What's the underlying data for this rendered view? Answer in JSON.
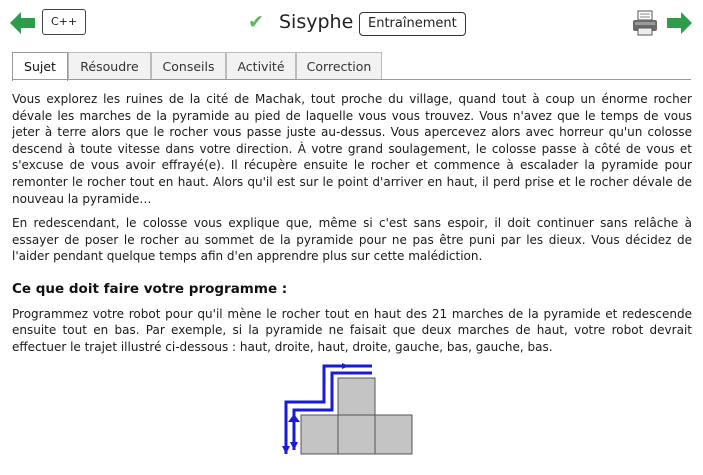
{
  "header": {
    "language": "C++",
    "title": "Sisyphe",
    "mode": "Entraînement",
    "colors": {
      "arrow": "#2e9c4a",
      "check": "#5cb85c"
    },
    "icons": [
      "prev-arrow-icon",
      "check-icon",
      "printer-icon",
      "next-arrow-icon"
    ]
  },
  "tabs": [
    {
      "label": "Sujet",
      "active": true
    },
    {
      "label": "Résoudre",
      "active": false
    },
    {
      "label": "Conseils",
      "active": false
    },
    {
      "label": "Activité",
      "active": false
    },
    {
      "label": "Correction",
      "active": false
    }
  ],
  "content": {
    "p1": "Vous explorez les ruines de la cité de Machak, tout proche du village, quand tout à coup un énorme rocher dévale les marches de la pyramide au pied de laquelle vous vous trouvez. Vous n'avez que le temps de vous jeter à terre alors que le rocher vous passe juste au-dessus. Vous apercevez alors avec horreur qu'un colosse descend à toute vitesse dans votre direction. À votre grand soulagement, le colosse passe à côté de vous et s'excuse de vous avoir effrayé(e). Il récupère ensuite le rocher et commence à escalader la pyramide pour remonter le rocher tout en haut. Alors qu'il est sur le point d'arriver en haut, il perd prise et le rocher dévale de nouveau la pyramide…",
    "p2": "En redescendant, le colosse vous explique que, même si c'est sans espoir, il doit continuer sans relâche à essayer de poser le rocher au sommet de la pyramide pour ne pas être puni par les dieux. Vous décidez de l'aider pendant quelque temps afin d'en apprendre plus sur cette malédiction.",
    "section_title": "Ce que doit faire votre programme :",
    "p3": "Programmez votre robot pour qu'il mène le rocher tout en haut des 21 marches de la pyramide et redescende ensuite tout en bas. Par exemple, si la pyramide ne faisait que deux marches de haut, votre robot devrait effectuer le trajet illustré ci-dessous : haut, droite, haut, droite, gauche, bas, gauche, bas."
  },
  "diagram": {
    "path_color": "#1a1adb",
    "block_color": "#c4c4c4"
  }
}
